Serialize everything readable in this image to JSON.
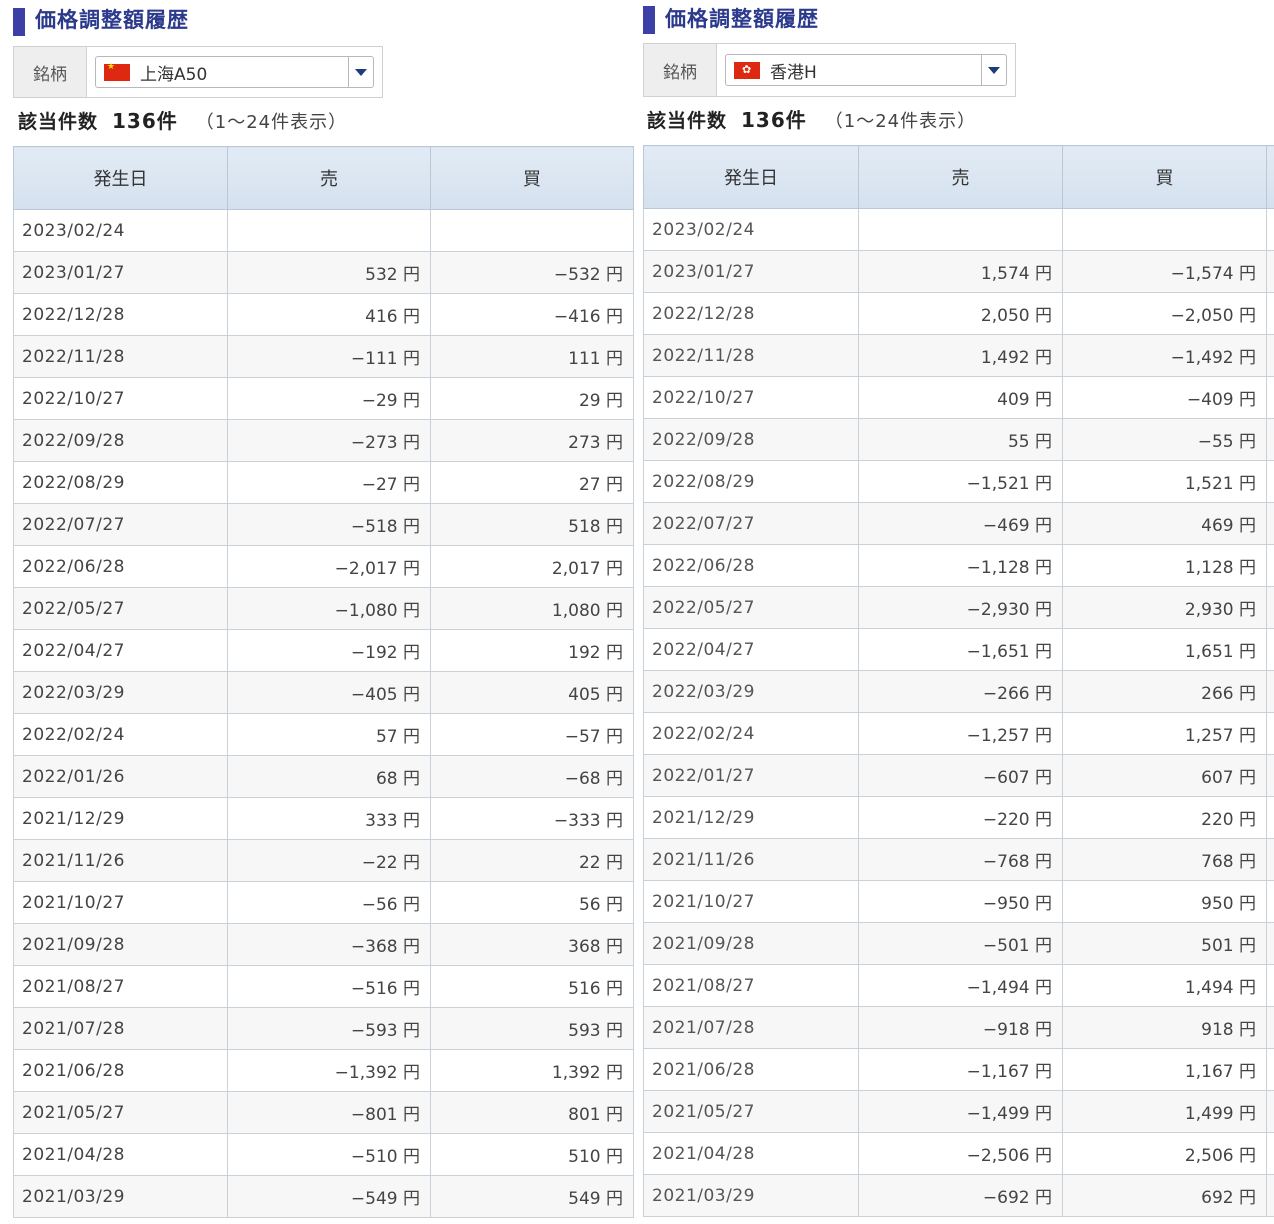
{
  "left": {
    "title": "価格調整額履歴",
    "selector_label": "銘柄",
    "selected": "上海A50",
    "flag_icon": "china-flag-icon",
    "count_label": "該当件数",
    "count_value": "136件",
    "count_range": "（1～24件表示）",
    "headers": [
      "発生日",
      "売",
      "買"
    ],
    "rows": [
      [
        "2023/02/24",
        "",
        ""
      ],
      [
        "2023/01/27",
        "532 円",
        "−532 円"
      ],
      [
        "2022/12/28",
        "416 円",
        "−416 円"
      ],
      [
        "2022/11/28",
        "−111 円",
        "111 円"
      ],
      [
        "2022/10/27",
        "−29 円",
        "29 円"
      ],
      [
        "2022/09/28",
        "−273 円",
        "273 円"
      ],
      [
        "2022/08/29",
        "−27 円",
        "27 円"
      ],
      [
        "2022/07/27",
        "−518 円",
        "518 円"
      ],
      [
        "2022/06/28",
        "−2,017 円",
        "2,017 円"
      ],
      [
        "2022/05/27",
        "−1,080 円",
        "1,080 円"
      ],
      [
        "2022/04/27",
        "−192 円",
        "192 円"
      ],
      [
        "2022/03/29",
        "−405 円",
        "405 円"
      ],
      [
        "2022/02/24",
        "57 円",
        "−57 円"
      ],
      [
        "2022/01/26",
        "68 円",
        "−68 円"
      ],
      [
        "2021/12/29",
        "333 円",
        "−333 円"
      ],
      [
        "2021/11/26",
        "−22 円",
        "22 円"
      ],
      [
        "2021/10/27",
        "−56 円",
        "56 円"
      ],
      [
        "2021/09/28",
        "−368 円",
        "368 円"
      ],
      [
        "2021/08/27",
        "−516 円",
        "516 円"
      ],
      [
        "2021/07/28",
        "−593 円",
        "593 円"
      ],
      [
        "2021/06/28",
        "−1,392 円",
        "1,392 円"
      ],
      [
        "2021/05/27",
        "−801 円",
        "801 円"
      ],
      [
        "2021/04/28",
        "−510 円",
        "510 円"
      ],
      [
        "2021/03/29",
        "−549 円",
        "549 円"
      ]
    ]
  },
  "right": {
    "title": "価格調整額履歴",
    "selector_label": "銘柄",
    "selected": "香港H",
    "flag_icon": "hong-kong-flag-icon",
    "count_label": "該当件数",
    "count_value": "136件",
    "count_range": "（1～24件表示）",
    "headers": [
      "発生日",
      "売",
      "買"
    ],
    "rows": [
      [
        "2023/02/24",
        "",
        ""
      ],
      [
        "2023/01/27",
        "1,574 円",
        "−1,574 円"
      ],
      [
        "2022/12/28",
        "2,050 円",
        "−2,050 円"
      ],
      [
        "2022/11/28",
        "1,492 円",
        "−1,492 円"
      ],
      [
        "2022/10/27",
        "409 円",
        "−409 円"
      ],
      [
        "2022/09/28",
        "55 円",
        "−55 円"
      ],
      [
        "2022/08/29",
        "−1,521 円",
        "1,521 円"
      ],
      [
        "2022/07/27",
        "−469 円",
        "469 円"
      ],
      [
        "2022/06/28",
        "−1,128 円",
        "1,128 円"
      ],
      [
        "2022/05/27",
        "−2,930 円",
        "2,930 円"
      ],
      [
        "2022/04/27",
        "−1,651 円",
        "1,651 円"
      ],
      [
        "2022/03/29",
        "−266 円",
        "266 円"
      ],
      [
        "2022/02/24",
        "−1,257 円",
        "1,257 円"
      ],
      [
        "2022/01/27",
        "−607 円",
        "607 円"
      ],
      [
        "2021/12/29",
        "−220 円",
        "220 円"
      ],
      [
        "2021/11/26",
        "−768 円",
        "768 円"
      ],
      [
        "2021/10/27",
        "−950 円",
        "950 円"
      ],
      [
        "2021/09/28",
        "−501 円",
        "501 円"
      ],
      [
        "2021/08/27",
        "−1,494 円",
        "1,494 円"
      ],
      [
        "2021/07/28",
        "−918 円",
        "918 円"
      ],
      [
        "2021/06/28",
        "−1,167 円",
        "1,167 円"
      ],
      [
        "2021/05/27",
        "−1,499 円",
        "1,499 円"
      ],
      [
        "2021/04/28",
        "−2,506 円",
        "2,506 円"
      ],
      [
        "2021/03/29",
        "−692 円",
        "692 円"
      ]
    ]
  }
}
